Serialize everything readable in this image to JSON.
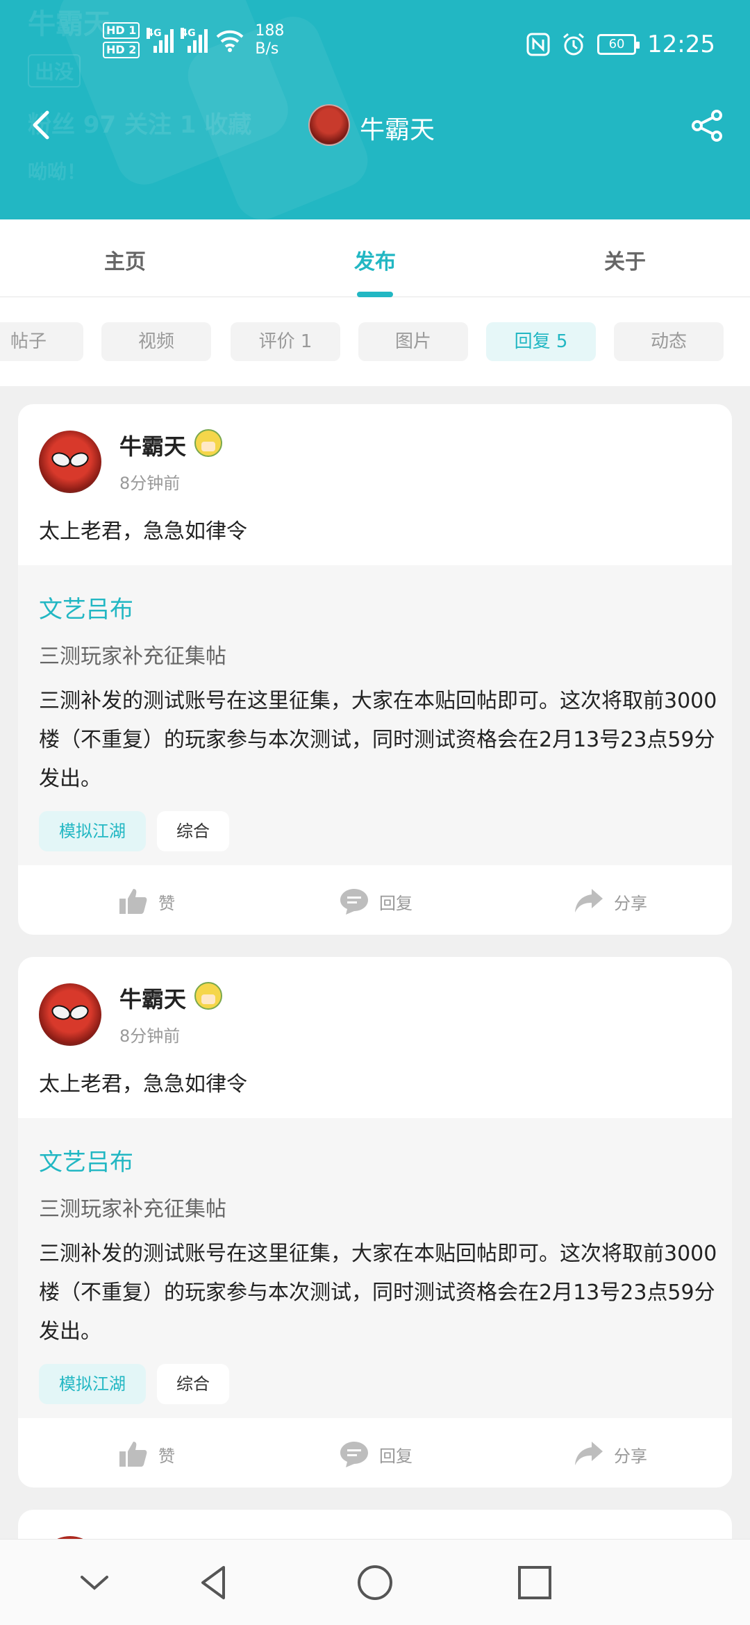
{
  "colors": {
    "accent": "#22b7c3",
    "background": "#f0f0f0"
  },
  "statusbar": {
    "hd1": "HD 1",
    "hd2": "HD 2",
    "sig1_label": "4G",
    "sig2_label": "4G",
    "speed_value": "188",
    "speed_unit": "B/s",
    "battery": "60",
    "time": "12:25",
    "icons": [
      "nfc-icon",
      "alarm-icon",
      "wifi-icon"
    ]
  },
  "header": {
    "ghost_name": "牛霸天",
    "ghost_badge": "出没",
    "ghost_stats": "粉丝  97  关注  1  收藏",
    "ghost_bio": "呦呦！",
    "title": "牛霸天",
    "back_icon": "back-arrow-icon",
    "share_icon": "share-icon"
  },
  "tabs": [
    {
      "label": "主页"
    },
    {
      "label": "发布"
    },
    {
      "label": "关于"
    }
  ],
  "chips": [
    {
      "label": "帖子"
    },
    {
      "label": "视频"
    },
    {
      "label": "评价 1"
    },
    {
      "label": "图片"
    },
    {
      "label": "回复 5"
    },
    {
      "label": "动态"
    }
  ],
  "cards": [
    {
      "user": "牛霸天",
      "time": "8分钟前",
      "comment": "太上老君，急急如律令",
      "quote": {
        "author": "文艺吕布",
        "title": "三测玩家补充征集帖",
        "body": "三测补发的测试账号在这里征集，大家在本贴回帖即可。这次将取前3000楼（不重复）的玩家参与本次测试，同时测试资格会在2月13号23点59分发出。",
        "tags": [
          "模拟江湖",
          "综合"
        ]
      },
      "actions": {
        "like": "赞",
        "reply": "回复",
        "share": "分享"
      }
    },
    {
      "user": "牛霸天",
      "time": "8分钟前",
      "comment": "太上老君，急急如律令",
      "quote": {
        "author": "文艺吕布",
        "title": "三测玩家补充征集帖",
        "body": "三测补发的测试账号在这里征集，大家在本贴回帖即可。这次将取前3000楼（不重复）的玩家参与本次测试，同时测试资格会在2月13号23点59分发出。",
        "tags": [
          "模拟江湖",
          "综合"
        ]
      },
      "actions": {
        "like": "赞",
        "reply": "回复",
        "share": "分享"
      }
    }
  ],
  "navbar": {
    "icons": [
      "collapse-icon",
      "back-triangle-icon",
      "home-circle-icon",
      "recents-square-icon"
    ]
  }
}
